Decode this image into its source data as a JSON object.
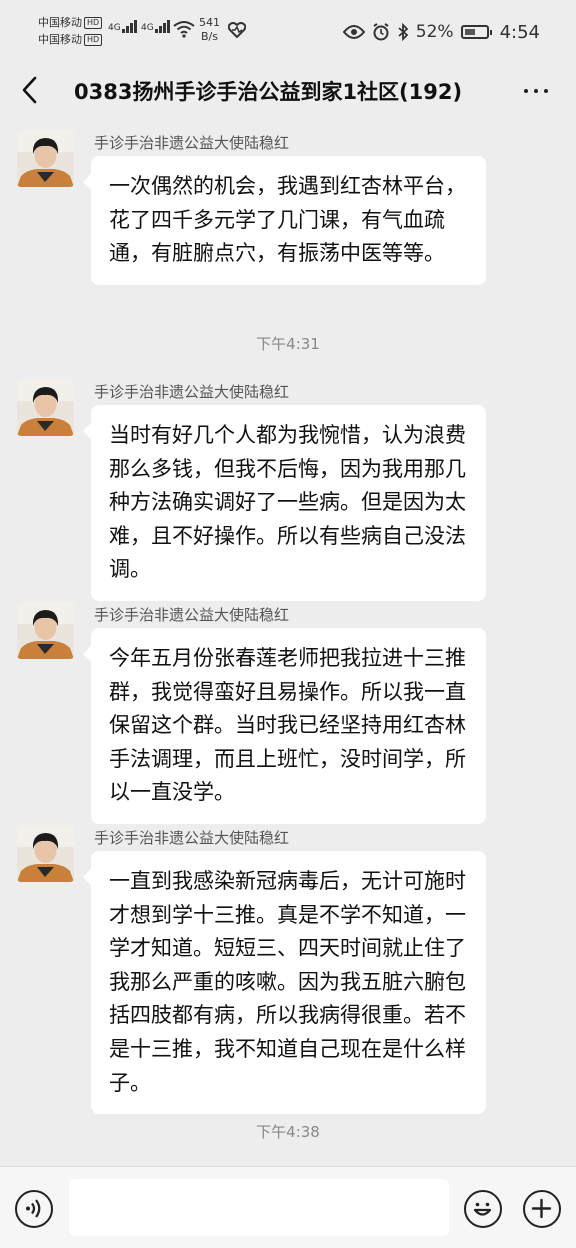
{
  "status_bar": {
    "carrier1": "中国移动",
    "carrier2": "中国移动",
    "hd": "HD",
    "net1": "4G",
    "net2": "4G",
    "speed_value": "541",
    "speed_unit": "B/s",
    "battery": "52%",
    "battery_level": 0.52,
    "time": "4:54"
  },
  "header": {
    "title": "0383扬州手诊手治公益到家1社区(192)"
  },
  "messages": [
    {
      "sender": "手诊手治非遗公益大使陆稳红",
      "text": "一次偶然的机会，我遇到红杏林平台，花了四千多元学了几门课，有气血疏通，有脏腑点穴，有振荡中医等等。"
    },
    {
      "sender": "手诊手治非遗公益大使陆稳红",
      "text": "当时有好几个人都为我惋惜，认为浪费那么多钱，但我不后悔，因为我用那几种方法确实调好了一些病。但是因为太难，且不好操作。所以有些病自己没法调。"
    },
    {
      "sender": "手诊手治非遗公益大使陆稳红",
      "text": "今年五月份张春莲老师把我拉进十三推群，我觉得蛮好且易操作。所以我一直保留这个群。当时我已经坚持用红杏林手法调理，而且上班忙，没时间学，所以一直没学。"
    },
    {
      "sender": "手诊手治非遗公益大使陆稳红",
      "text": "一直到我感染新冠病毒后，无计可施时才想到学十三推。真是不学不知道，一学才知道。短短三、四天时间就止住了我那么严重的咳嗽。因为我五脏六腑包括四肢都有病，所以我病得很重。若不是十三推，我不知道自己现在是什么样子。"
    }
  ],
  "timestamps": [
    "下午4:31",
    "下午4:38"
  ],
  "input_bar": {
    "voice_icon": "voice-icon",
    "emoji_icon": "emoji-icon",
    "plus_icon": "plus-icon",
    "text_value": ""
  }
}
